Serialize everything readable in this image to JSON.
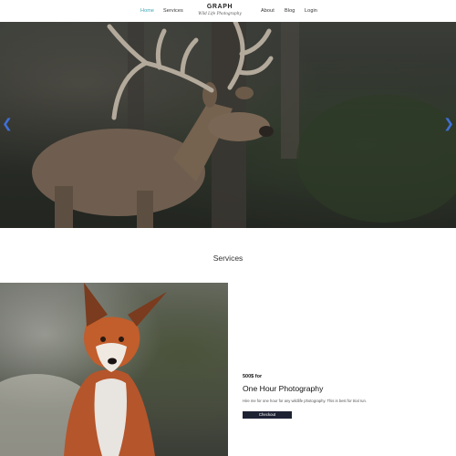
{
  "nav": {
    "items": [
      "Home",
      "Services",
      "About",
      "Blog",
      "Login"
    ],
    "active_index": 0,
    "active_color": "#3aa7b7"
  },
  "brand": {
    "name": "GRAPH",
    "tagline": "Wild Life Photography"
  },
  "hero": {
    "image": "deer-stag-in-forest",
    "prev_icon": "chevron-left-icon",
    "next_icon": "chevron-right-icon",
    "arrow_color": "#3f6fd6"
  },
  "services": {
    "title": "Services",
    "item": {
      "image": "red-fox-sitting",
      "price": "500$ for",
      "name": "One Hour Photography",
      "description": "Hire me for one hour for any wildlife photography. This is best for trial run.",
      "button_label": "Checkout",
      "button_color": "#1d2233"
    }
  }
}
